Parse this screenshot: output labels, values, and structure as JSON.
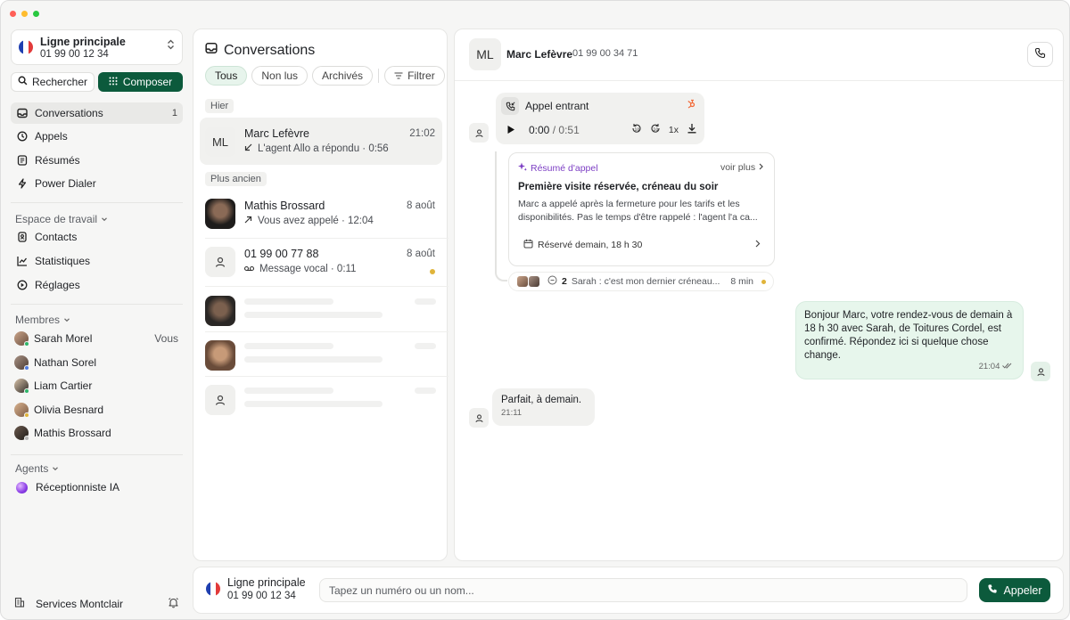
{
  "colors": {
    "accent": "#0c5a3c",
    "purple": "#7d3fc4",
    "unread": "#e0b43a",
    "traffic_red": "#ff5f57",
    "traffic_yellow": "#febc2e",
    "traffic_green": "#28c840"
  },
  "line": {
    "name": "Ligne principale",
    "number": "01 99 00 12 34",
    "flag": "fr-flag-icon"
  },
  "sidebar": {
    "search_label": "Rechercher",
    "compose_label": "Composer",
    "nav": [
      {
        "label": "Conversations",
        "count": "1",
        "icon": "inbox-icon"
      },
      {
        "label": "Appels",
        "icon": "clock-icon"
      },
      {
        "label": "Résumés",
        "icon": "document-icon"
      },
      {
        "label": "Power Dialer",
        "icon": "bolt-icon"
      }
    ],
    "workspace_header": "Espace de travail",
    "workspace": [
      {
        "label": "Contacts",
        "icon": "contact-icon"
      },
      {
        "label": "Statistiques",
        "icon": "chart-icon"
      },
      {
        "label": "Réglages",
        "icon": "settings-icon"
      }
    ],
    "members_header": "Membres",
    "members": [
      {
        "name": "Sarah Morel",
        "tag": "Vous",
        "status": "#2fb66a"
      },
      {
        "name": "Nathan Sorel",
        "status": "#4f7ae0"
      },
      {
        "name": "Liam Cartier",
        "status": "#2fb66a"
      },
      {
        "name": "Olivia Besnard",
        "status": "#e0b43a"
      },
      {
        "name": "Mathis Brossard",
        "status": "#b5b5b5"
      }
    ],
    "agents_header": "Agents",
    "agents": [
      {
        "name": "Réceptionniste IA"
      }
    ],
    "company": "Services Montclair"
  },
  "conversations": {
    "title": "Conversations",
    "filters": {
      "all": "Tous",
      "unread": "Non lus",
      "archived": "Archivés",
      "filter": "Filtrer"
    },
    "group_yesterday": "Hier",
    "group_older": "Plus ancien",
    "items": [
      {
        "initials": "ML",
        "name": "Marc Lefèvre",
        "date": "21:02",
        "preview": "L'agent Allo a répondu · 0:56"
      },
      {
        "name": "Mathis Brossard",
        "date": "8 août",
        "preview": "Vous avez appelé · 12:04"
      },
      {
        "name": "01 99 00 77 88",
        "date": "8 août",
        "preview": "Message vocal · 0:11"
      }
    ]
  },
  "chat": {
    "initials": "ML",
    "name": "Marc Lefèvre",
    "number": "01 99 00 34 71",
    "call": {
      "title": "Appel entrant",
      "current": "0:00",
      "separator": "/",
      "total": "0:51",
      "speed": "1x"
    },
    "summary": {
      "label": "Résumé d'appel",
      "more": "voir plus",
      "title": "Première visite réservée, créneau du soir",
      "text": "Marc a appelé après la fermeture pour les tarifs et les disponibilités. Pas le temps d'être rappelé : l'agent l'a ca...",
      "booking": "Réservé demain, 18 h 30"
    },
    "thread": {
      "count": "2",
      "preview": "Sarah : c'est mon dernier créneau...",
      "time": "8 min"
    },
    "outgoing": {
      "text": "Bonjour Marc, votre rendez-vous de demain à 18 h 30 avec Sarah, de Toitures Cordel, est confirmé. Répondez ici si quelque chose change.",
      "time": "21:04"
    },
    "incoming": {
      "text": "Parfait, à demain.",
      "time": "21:11"
    }
  },
  "composer": {
    "placeholder": "Tapez un numéro ou un nom...",
    "call_label": "Appeler"
  }
}
